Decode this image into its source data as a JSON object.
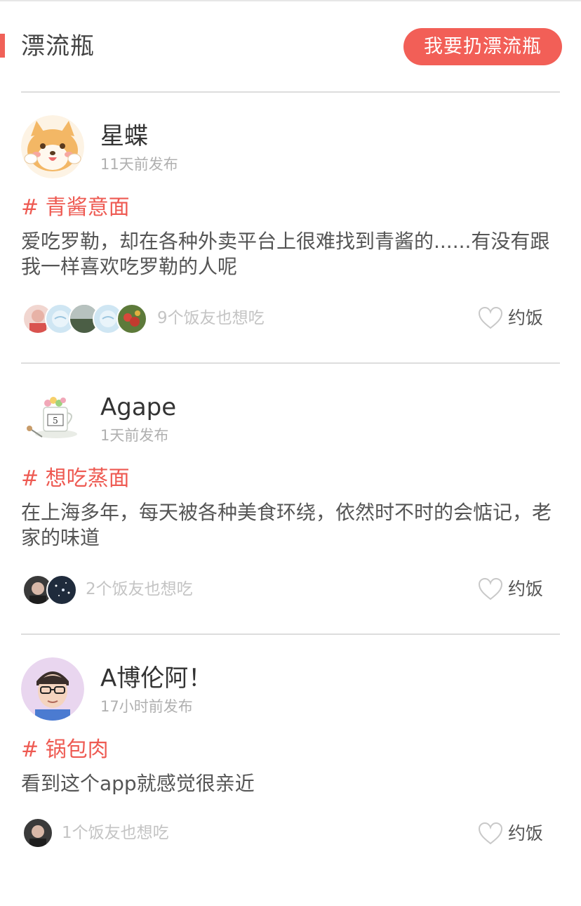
{
  "header": {
    "title": "漂流瓶",
    "throw_button": "我要扔漂流瓶",
    "accent_color": "#f25f57"
  },
  "posts": [
    {
      "username": "星蝶",
      "time": "11天前发布",
      "tag": "# 青酱意面",
      "content": "爱吃罗勒，却在各种外卖平台上很难找到青酱的......有没有跟我一样喜欢吃罗勒的人呢",
      "friends_text": "9个饭友也想吃",
      "action_label": "约饭",
      "action_icon": "heart-outline-icon"
    },
    {
      "username": "Agape",
      "time": "1天前发布",
      "tag": "# 想吃蒸面",
      "content": "在上海多年，每天被各种美食环绕，依然时不时的会惦记，老家的味道",
      "friends_text": "2个饭友也想吃",
      "action_label": "约饭",
      "action_icon": "heart-outline-icon"
    },
    {
      "username": "A博伦阿！",
      "time": "17小时前发布",
      "tag": "# 锅包肉",
      "content": "看到这个app就感觉很亲近",
      "friends_text": "1个饭友也想吃",
      "action_label": "约饭",
      "action_icon": "heart-outline-icon"
    }
  ]
}
